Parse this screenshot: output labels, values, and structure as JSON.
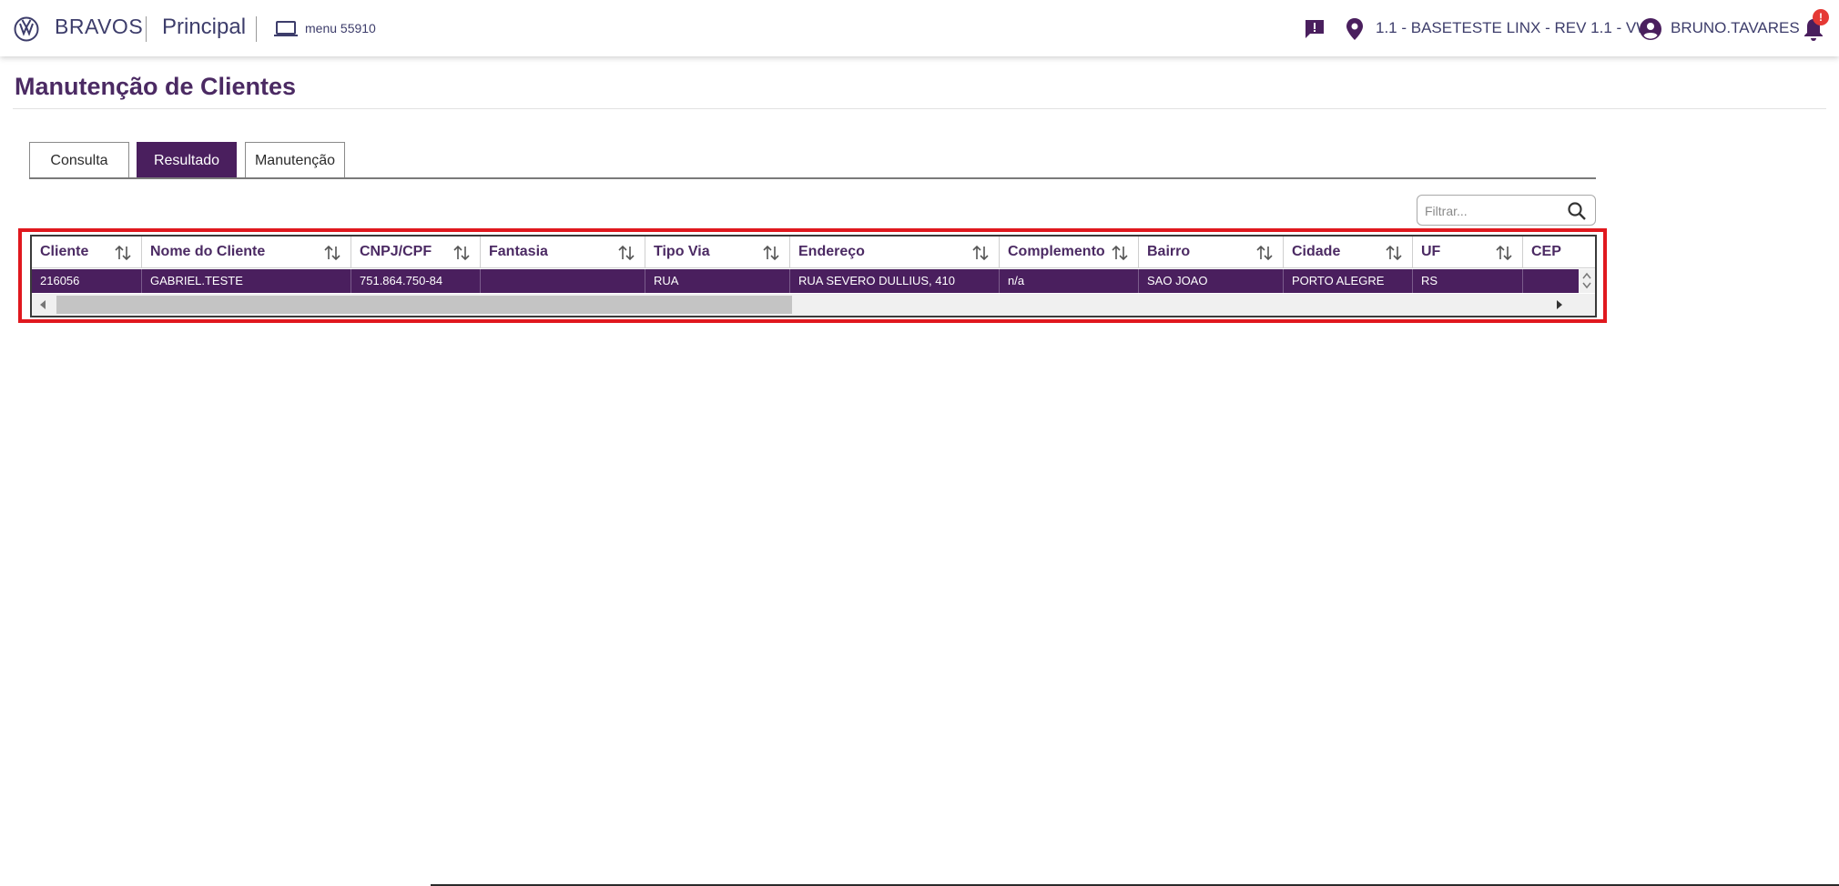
{
  "header": {
    "brand": "BRAVOS",
    "section": "Principal",
    "menu_code": "menu 55910",
    "location": "1.1 - BASETESTE LINX - REV 1.1 - VW",
    "username": "BRUNO.TAVARES",
    "notification_badge": "!"
  },
  "page": {
    "title": "Manutenção de Clientes"
  },
  "tabs": [
    {
      "label": "Consulta",
      "active": false
    },
    {
      "label": "Resultado",
      "active": true
    },
    {
      "label": "Manutenção",
      "active": false
    }
  ],
  "filter": {
    "placeholder": "Filtrar..."
  },
  "grid": {
    "columns": [
      "Cliente",
      "Nome do Cliente",
      "CNPJ/CPF",
      "Fantasia",
      "Tipo Via",
      "Endereço",
      "Complemento",
      "Bairro",
      "Cidade",
      "UF",
      "CEP"
    ],
    "rows": [
      [
        "216056",
        "GABRIEL.TESTE",
        "751.864.750-84",
        "",
        "RUA",
        "RUA SEVERO DULLIUS, 410",
        "n/a",
        "SAO JOAO",
        "PORTO ALEGRE",
        "RS",
        ""
      ]
    ]
  },
  "colors": {
    "primary": "#4a1f5e",
    "title": "#4b2a63",
    "highlight": "#e0181e",
    "badge": "#e53935"
  }
}
